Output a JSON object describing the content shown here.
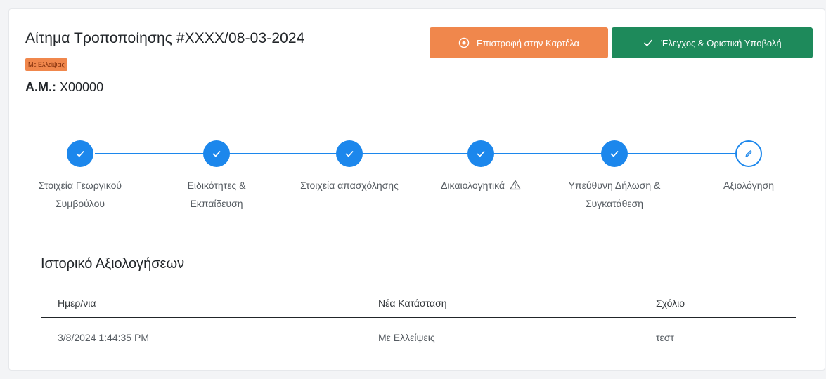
{
  "header": {
    "title": "Αίτημα Τροποποίησης #XXXX/08-03-2024",
    "status_badge": "Με Ελλείψεις",
    "am_label": "Α.Μ.:",
    "am_value": "X00000",
    "back_button_label": "Επιστροφή στην Καρτέλα",
    "submit_button_label": "Έλεγχος & Οριστική Υποβολή"
  },
  "stepper": {
    "steps": [
      {
        "label_line1": "Στοιχεία Γεωργικού",
        "label_line2": "Συμβούλου",
        "state": "complete",
        "icon": "check-icon"
      },
      {
        "label_line1": "Ειδικότητες &",
        "label_line2": "Εκπαίδευση",
        "state": "complete",
        "icon": "check-icon"
      },
      {
        "label_line1": "Στοιχεία απασχόλησης",
        "label_line2": "",
        "state": "complete",
        "icon": "check-icon"
      },
      {
        "label_line1": "Δικαιολογητικά",
        "label_line2": "",
        "state": "complete",
        "icon": "check-icon",
        "warning_icon": "warning-icon"
      },
      {
        "label_line1": "Υπεύθυνη Δήλωση &",
        "label_line2": "Συγκατάθεση",
        "state": "complete",
        "icon": "check-icon"
      },
      {
        "label_line1": "Αξιολόγηση",
        "label_line2": "",
        "state": "current",
        "icon": "pencil-icon"
      }
    ]
  },
  "history": {
    "title": "Ιστορικό Αξιολογήσεων",
    "columns": [
      "Ημερ/νια",
      "Νέα Κατάσταση",
      "Σχόλιο"
    ],
    "rows": [
      [
        "3/8/2024 1:44:35 PM",
        "Με Ελλείψεις",
        "τεστ"
      ]
    ]
  },
  "colors": {
    "accent_blue": "#1c87ec",
    "back_button_orange": "#f0874c",
    "submit_button_green": "#1e8a5b"
  }
}
